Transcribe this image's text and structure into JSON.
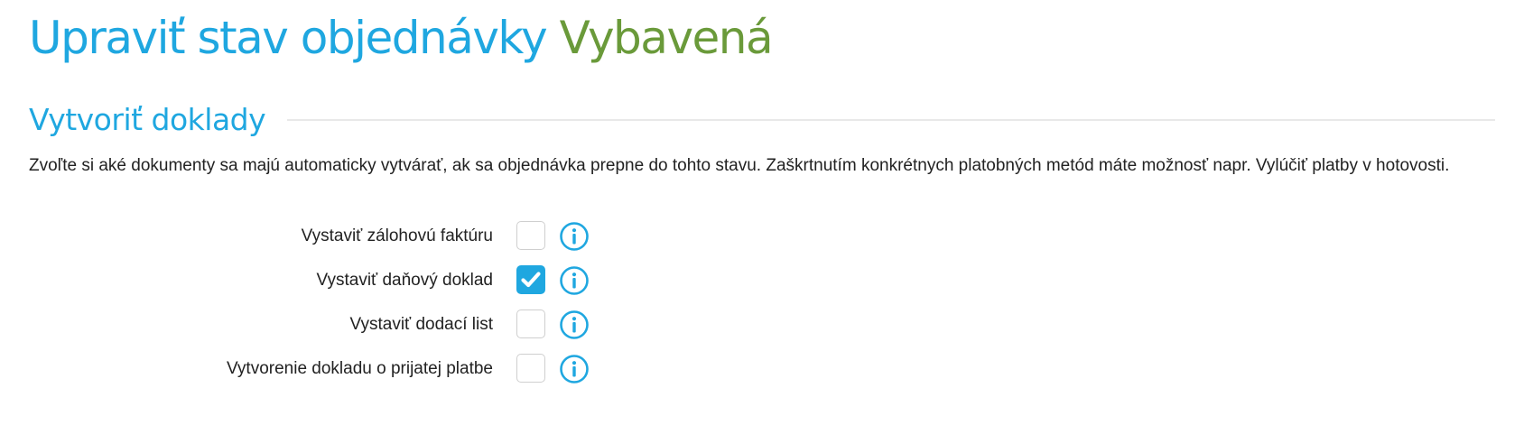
{
  "header": {
    "title_main": "Upraviť stav objednávky",
    "title_state": "Vybavená"
  },
  "section": {
    "heading": "Vytvoriť doklady",
    "description": "Zvoľte si aké dokumenty sa majú automaticky vytvárať, ak sa objednávka prepne do tohto stavu. Zaškrtnutím konkrétnych platobných metód máte možnosť napr. Vylúčiť platby v hotovosti."
  },
  "options": [
    {
      "label": "Vystaviť zálohovú faktúru",
      "checked": false
    },
    {
      "label": "Vystaviť daňový doklad",
      "checked": true
    },
    {
      "label": "Vystaviť dodací list",
      "checked": false
    },
    {
      "label": "Vytvorenie dokladu o prijatej platbe",
      "checked": false
    }
  ],
  "icons": {
    "info": "info-icon",
    "check": "check-icon"
  },
  "colors": {
    "accent_blue": "#1fa7e0",
    "state_green": "#6a9a3a",
    "text": "#222222",
    "checkbox_border": "#cfcfcf",
    "divider": "#e8e8e8"
  }
}
